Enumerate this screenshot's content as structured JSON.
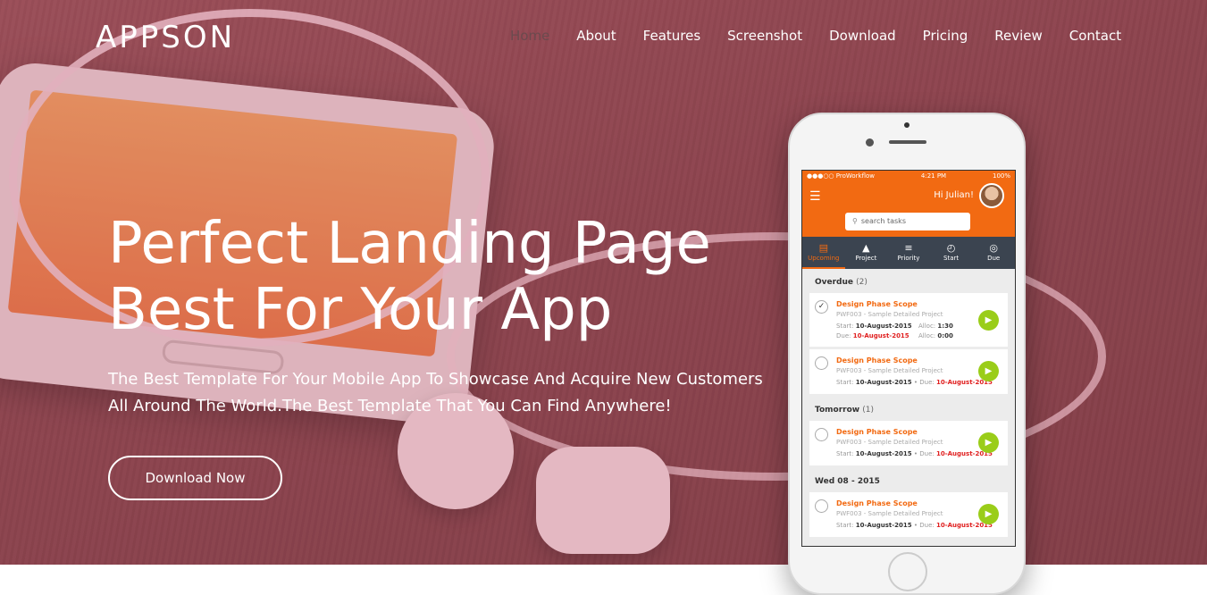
{
  "brand": {
    "logo": "APPSON"
  },
  "nav": {
    "items": [
      "Home",
      "About",
      "Features",
      "Screenshot",
      "Download",
      "Pricing",
      "Review",
      "Contact"
    ],
    "active": "Home"
  },
  "hero": {
    "headline_line1": "Perfect Landing Page",
    "headline_line2": "Best For Your App",
    "subtext_line1": "The Best Template For Your Mobile App To Showcase And Acquire New Customers",
    "subtext_line2": "All Around The World.The Best Template That You Can Find Anywhere!",
    "cta_label": "Download Now"
  },
  "app": {
    "status": {
      "carrier": "●●●○○ ProWorkflow",
      "time": "4:21 PM",
      "battery": "100%"
    },
    "greeting": "Hi Julian!",
    "search_placeholder": "search tasks",
    "tabs": [
      {
        "label": "Upcoming",
        "icon": "▤"
      },
      {
        "label": "Project",
        "icon": "▲"
      },
      {
        "label": "Priority",
        "icon": "≡"
      },
      {
        "label": "Start",
        "icon": "◴"
      },
      {
        "label": "Due",
        "icon": "◎"
      }
    ],
    "sections": {
      "overdue": {
        "title": "Overdue",
        "count": "(2)"
      },
      "tomorrow": {
        "title": "Tomorrow",
        "count": "(1)"
      },
      "wed": {
        "title": "Wed 08 - 2015",
        "count": ""
      }
    },
    "task1": {
      "title": "Design Phase Scope",
      "sub": "PWF003 - Sample Detailed Project",
      "start_label": "Start:",
      "start": "10-August-2015",
      "due_label": "Due:",
      "due": "10-August-2015",
      "alloc_label": "Alloc:",
      "alloc1": "1:30",
      "alloc2": "0:00"
    },
    "task2": {
      "title": "Design Phase Scope",
      "sub": "PWF003 - Sample Detailed Project",
      "start_label": "Start:",
      "start": "10-August-2015",
      "due_label": "• Due:",
      "due": "10-August-2015"
    },
    "task3": {
      "title": "Design Phase Scope",
      "sub": "PWF003 - Sample Detailed Project",
      "start_label": "Start:",
      "start": "10-August-2015",
      "due_label": "• Due:",
      "due": "10-August-2015"
    },
    "task4": {
      "title": "Design Phase Scope",
      "sub": "PWF003 - Sample Detailed Project",
      "start_label": "Start:",
      "start": "10-August-2015",
      "due_label": "• Due:",
      "due": "10-August-2015"
    }
  },
  "colors": {
    "accent": "#f26a12",
    "tab_bar": "#3b4450",
    "play": "#9acd19",
    "due": "#e02020"
  }
}
